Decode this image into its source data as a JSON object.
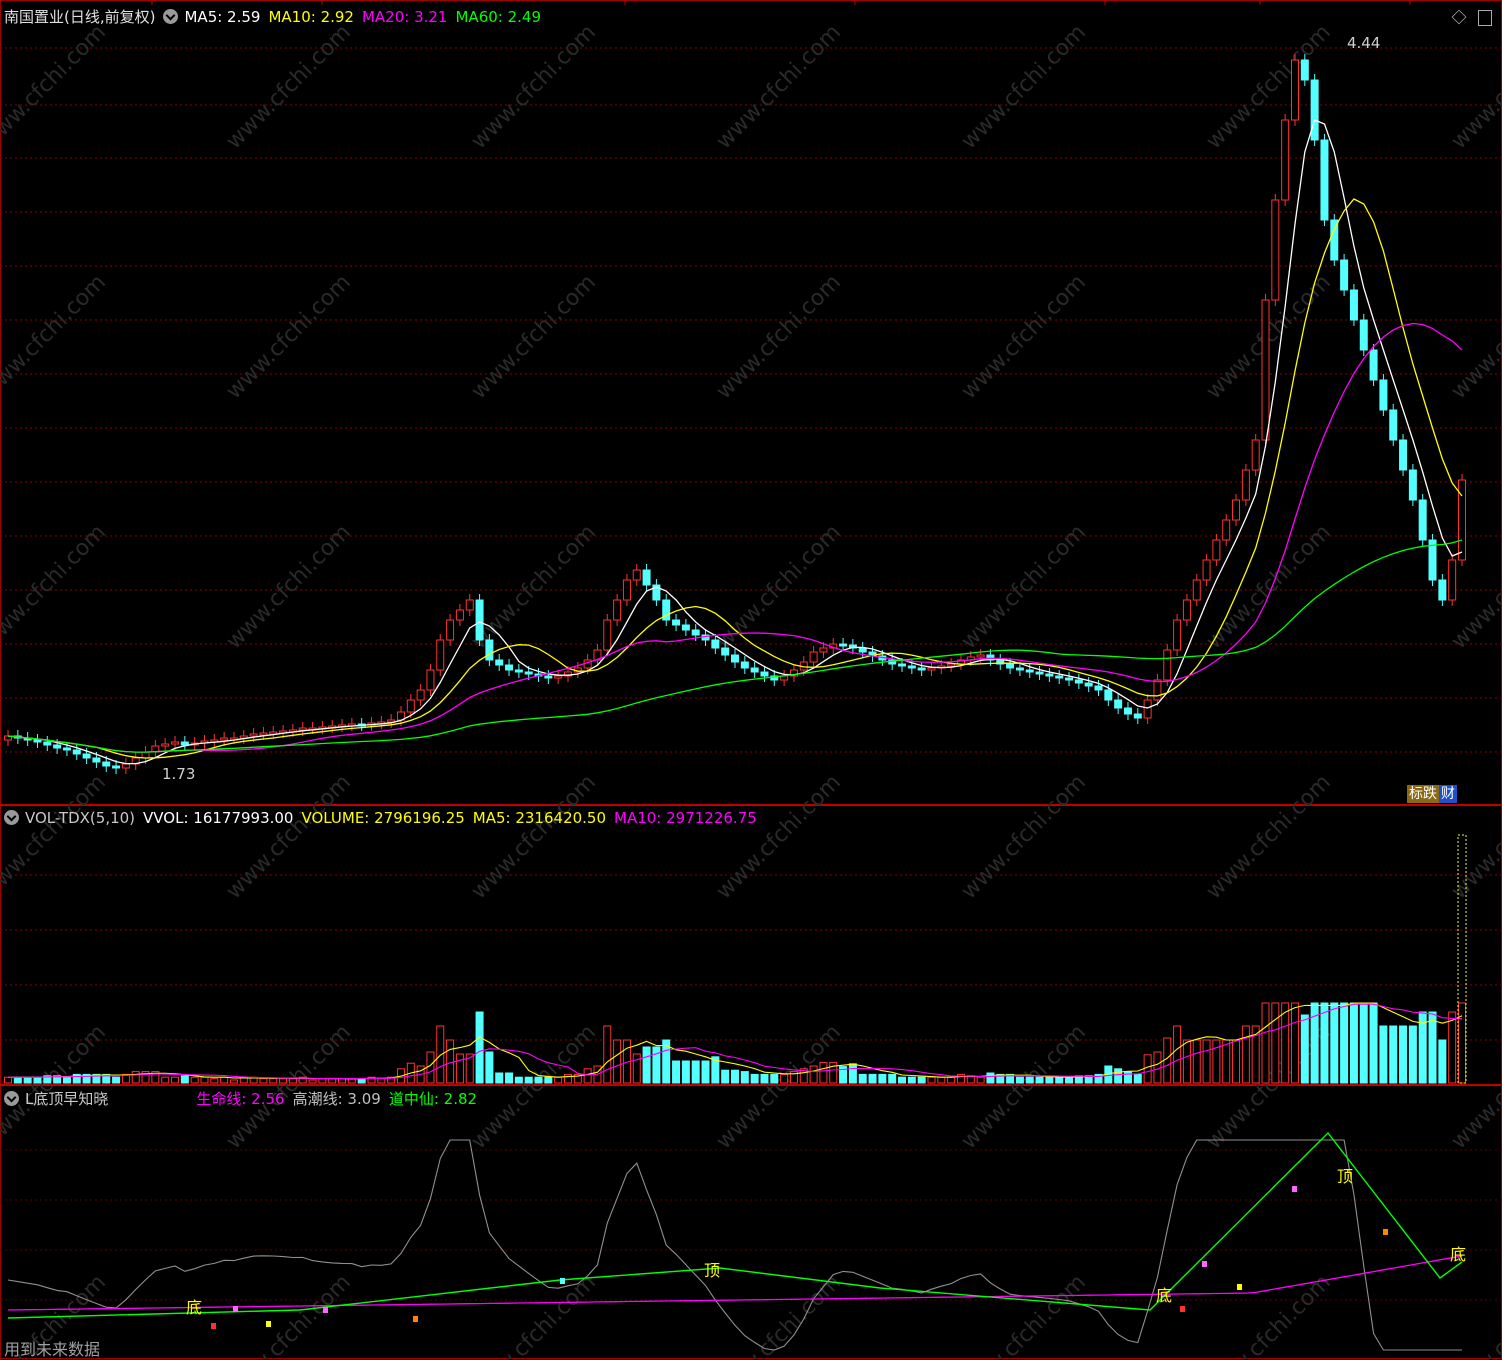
{
  "main_header": {
    "stock_name": "南国置业(日线,前复权)",
    "ma5": "MA5: 2.59",
    "ma10": "MA10: 2.92",
    "ma20": "MA20: 3.21",
    "ma60": "MA60: 2.49"
  },
  "price_annotations": {
    "high": "4.44",
    "low": "1.73"
  },
  "badges": {
    "limit": "标跌",
    "finance": "财"
  },
  "volume_header": {
    "indicator": "VOL-TDX(5,10)",
    "vvol": "VVOL: 16177993.00",
    "volume": "VOLUME: 2796196.25",
    "ma5": "MA5: 2316420.50",
    "ma10": "MA10: 2971226.75"
  },
  "indicator_header": {
    "name": "L底顶早知晓",
    "lifeline": "生命线: 2.56",
    "high_tide": "高潮线: 3.09",
    "dao_zhong_xian": "道中仙: 2.82"
  },
  "signals": {
    "bottom": "底",
    "top": "顶"
  },
  "footer_note": "用到未来数据",
  "watermark": "www.cfchi.com",
  "colors": {
    "up": "#ff3232",
    "down": "#54ffff",
    "ma5": "#ffffff",
    "ma10": "#ffff00",
    "ma20": "#ff00ff",
    "ma60": "#00ff00",
    "grid": "#8b0000"
  }
}
